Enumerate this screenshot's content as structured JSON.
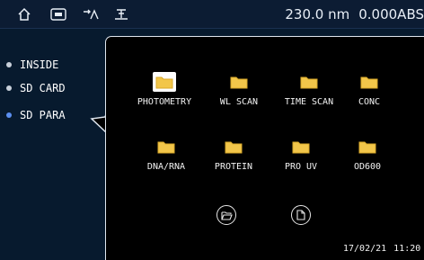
{
  "topbar": {
    "icons": [
      "home-icon",
      "keyboard-icon",
      "signal-icon",
      "tools-icon"
    ],
    "wavelength": "230.0 nm",
    "absorbance": "0.000ABS"
  },
  "sidebar": {
    "items": [
      {
        "label": "INSIDE",
        "active": false
      },
      {
        "label": "SD CARD",
        "active": false
      },
      {
        "label": "SD PARA",
        "active": true
      }
    ]
  },
  "folders": [
    {
      "label": "PHOTOMETRY",
      "selected": true
    },
    {
      "label": "WL SCAN",
      "selected": false
    },
    {
      "label": "TIME SCAN",
      "selected": false
    },
    {
      "label": "CONC",
      "selected": false
    },
    {
      "label": "DNA/RNA",
      "selected": false
    },
    {
      "label": "PROTEIN",
      "selected": false
    },
    {
      "label": "PRO UV",
      "selected": false
    },
    {
      "label": "OD600",
      "selected": false
    }
  ],
  "actions": [
    "open-folder-icon",
    "file-icon"
  ],
  "footer": {
    "date": "17/02/21",
    "time": "11:20"
  },
  "colors": {
    "background": "#071a2e",
    "panel": "#000000",
    "folder": "#f2c64a",
    "active_dot": "#5b8ff0"
  }
}
